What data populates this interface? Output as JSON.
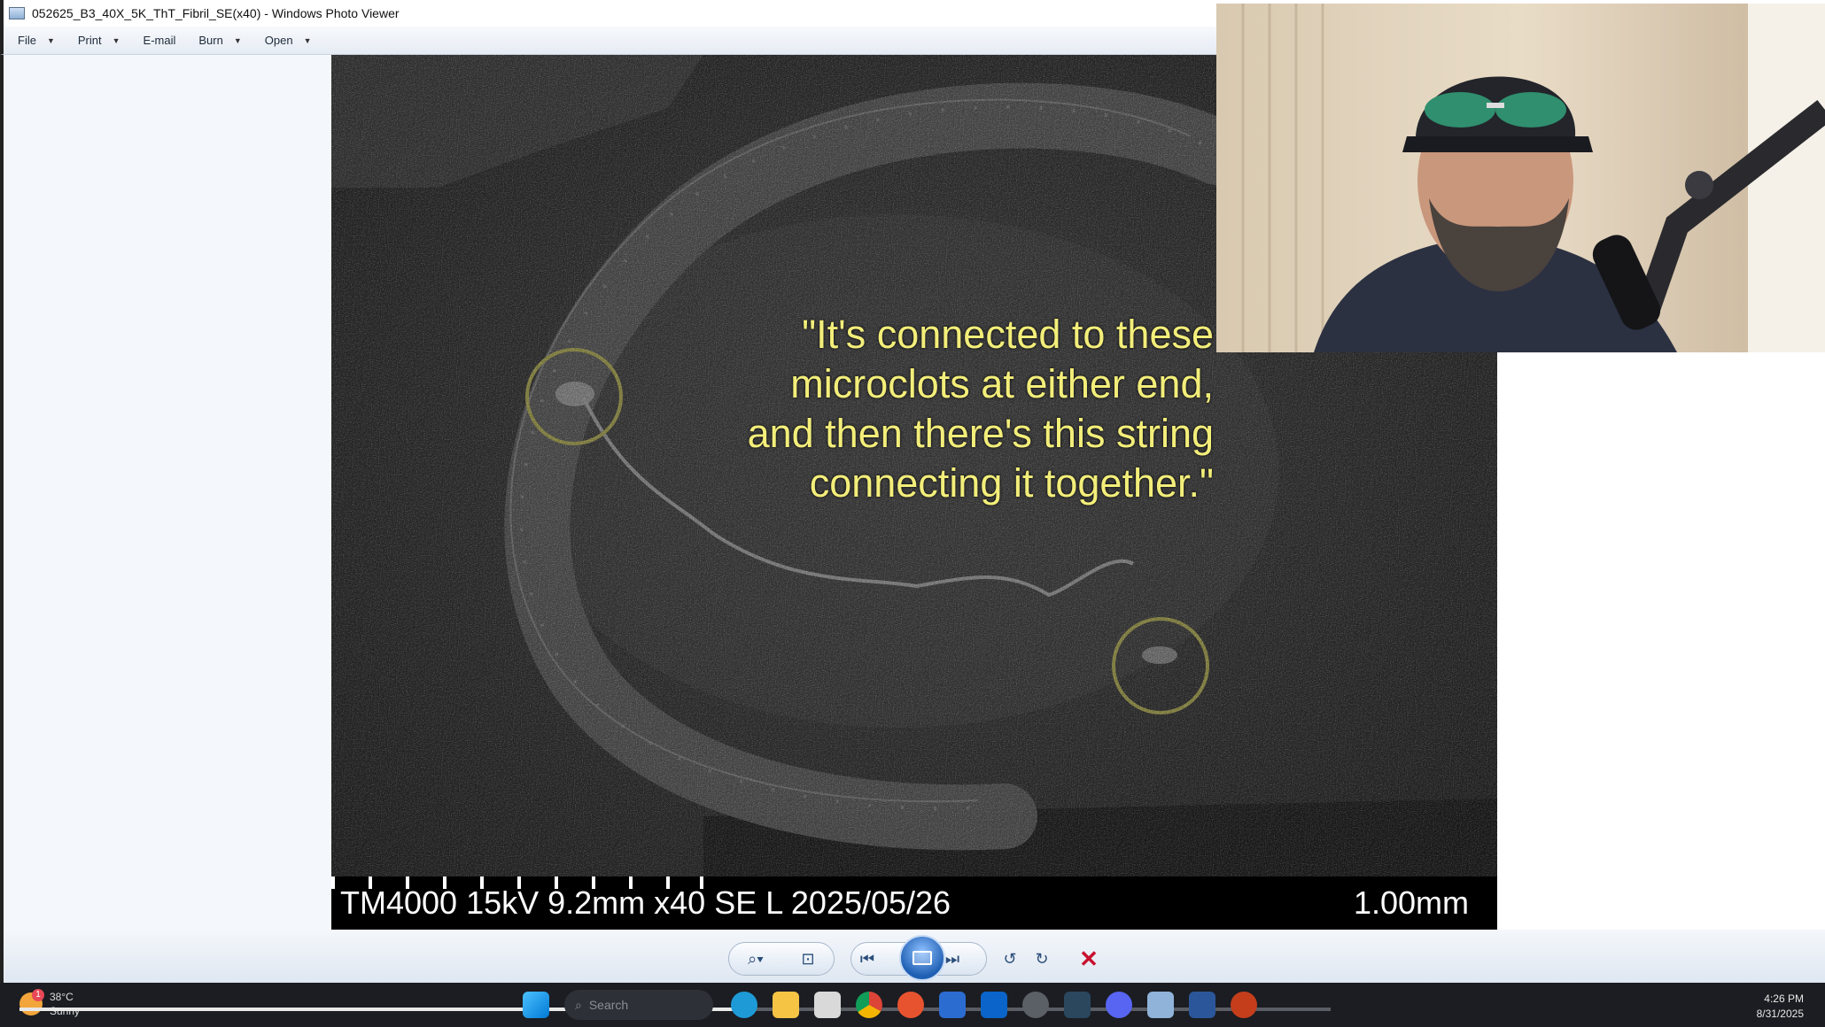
{
  "window": {
    "title": "052625_B3_40X_5K_ThT_Fibril_SE(x40) - Windows Photo Viewer"
  },
  "menu": [
    {
      "label": "File",
      "has_dropdown": true
    },
    {
      "label": "Print",
      "has_dropdown": true
    },
    {
      "label": "E-mail",
      "has_dropdown": false
    },
    {
      "label": "Burn",
      "has_dropdown": true
    },
    {
      "label": "Open",
      "has_dropdown": true
    }
  ],
  "image": {
    "caption_left": "TM4000 15kV 9.2mm x40 SE L 2025/05/26",
    "caption_right": "1.00mm",
    "quote_lines": [
      "\"It's connected to these",
      "microclots at either end,",
      "and then there's this string",
      "connecting it together.\""
    ],
    "annotation_color": "#f3ee7a"
  },
  "viewer_toolbar": {
    "buttons": [
      "zoom-icon",
      "actual-size-icon",
      "previous-icon",
      "slideshow-icon",
      "next-icon",
      "rotate-ccw-icon",
      "rotate-cw-icon",
      "delete-icon"
    ]
  },
  "taskbar": {
    "weather": {
      "temp": "38°C",
      "condition": "Sunny",
      "badge": "1"
    },
    "search_placeholder": "Search",
    "video_progress": 0.56,
    "clock": {
      "time": "4:26 PM",
      "date": "8/31/2025"
    },
    "apps": [
      "start-icon",
      "search-icon",
      "edge-icon",
      "file-explorer-icon",
      "notepad-icon",
      "chrome-icon",
      "app-icon",
      "remote-icon",
      "outlook-icon",
      "settings-icon",
      "steam-icon",
      "discord-icon",
      "photo-viewer-icon",
      "word-icon",
      "powerpoint-icon"
    ]
  }
}
